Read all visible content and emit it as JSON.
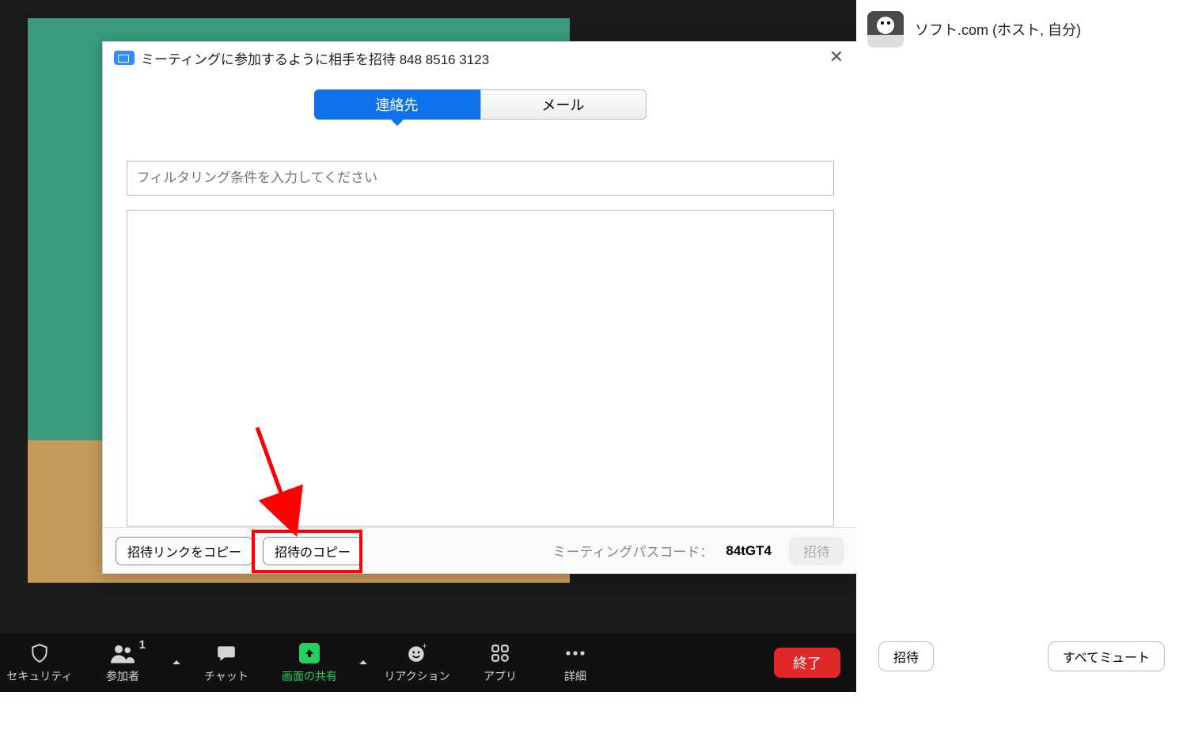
{
  "dialog": {
    "title": "ミーティングに参加するように相手を招待 848 8516 3123",
    "tabs": {
      "contacts": "連絡先",
      "email": "メール"
    },
    "filter_placeholder": "フィルタリング条件を入力してください",
    "copy_link": "招待リンクをコピー",
    "copy_invite": "招待のコピー",
    "passcode_label": "ミーティングパスコード：",
    "passcode_value": "84tGT4",
    "invite_btn": "招待"
  },
  "toolbar": {
    "security": "セキュリティ",
    "participants": "参加者",
    "participants_count": "1",
    "chat": "チャット",
    "share": "画面の共有",
    "reactions": "リアクション",
    "apps": "アプリ",
    "more": "詳細",
    "end": "終了"
  },
  "side": {
    "participant_name": "ソフト.com (ホスト, 自分)",
    "invite": "招待",
    "mute_all": "すべてミュート"
  }
}
